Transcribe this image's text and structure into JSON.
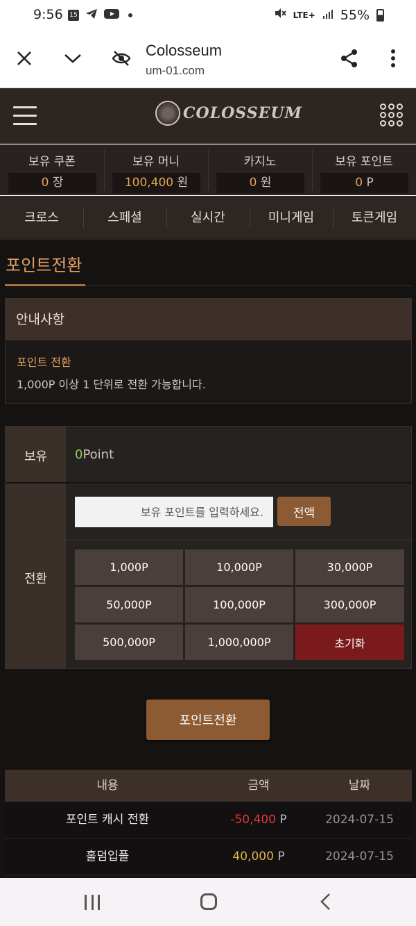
{
  "status_bar": {
    "time": "9:56",
    "calendar_badge": "15",
    "network": "LTE+",
    "battery": "55%"
  },
  "browser": {
    "title": "Colosseum",
    "url": "um-01.com"
  },
  "site": {
    "logo_text": "COLOSSEUM"
  },
  "balances": [
    {
      "label": "보유 쿠폰",
      "value": "0",
      "unit": "장"
    },
    {
      "label": "보유 머니",
      "value": "100,400",
      "unit": "원"
    },
    {
      "label": "카지노",
      "value": "0",
      "unit": "원"
    },
    {
      "label": "보유 포인트",
      "value": "0",
      "unit": "P"
    }
  ],
  "nav": {
    "items": [
      "크로스",
      "스페셜",
      "실시간",
      "미니게임",
      "토큰게임"
    ]
  },
  "page": {
    "title": "포인트전환"
  },
  "notice": {
    "heading": "안내사항",
    "subtitle": "포인트 전환",
    "text": "1,000P 이상 1 단위로 전환 가능합니다."
  },
  "convert": {
    "held_label": "보유",
    "held_value": "0",
    "held_unit": "Point",
    "convert_label": "전환",
    "input_placeholder": "보유 포인트를 입력하세요.",
    "all_button": "전액",
    "amounts": [
      "1,000P",
      "10,000P",
      "30,000P",
      "50,000P",
      "100,000P",
      "300,000P",
      "500,000P",
      "1,000,000P"
    ],
    "reset_button": "초기화",
    "submit_button": "포인트전환"
  },
  "history": {
    "headers": {
      "content": "내용",
      "amount": "금액",
      "date": "날짜"
    },
    "rows": [
      {
        "content": "포인트 캐시 전환",
        "amount": "-50,400",
        "unit": "P",
        "date": "2024-07-15"
      },
      {
        "content": "홀덤입플",
        "amount": "40,000",
        "unit": "P",
        "date": "2024-07-15"
      }
    ]
  },
  "colors": {
    "accent": "#8c5b33",
    "title_orange": "#e0a066",
    "negative": "#e0393a",
    "positive": "#e4b24b",
    "held_zero": "#8fd25a"
  }
}
